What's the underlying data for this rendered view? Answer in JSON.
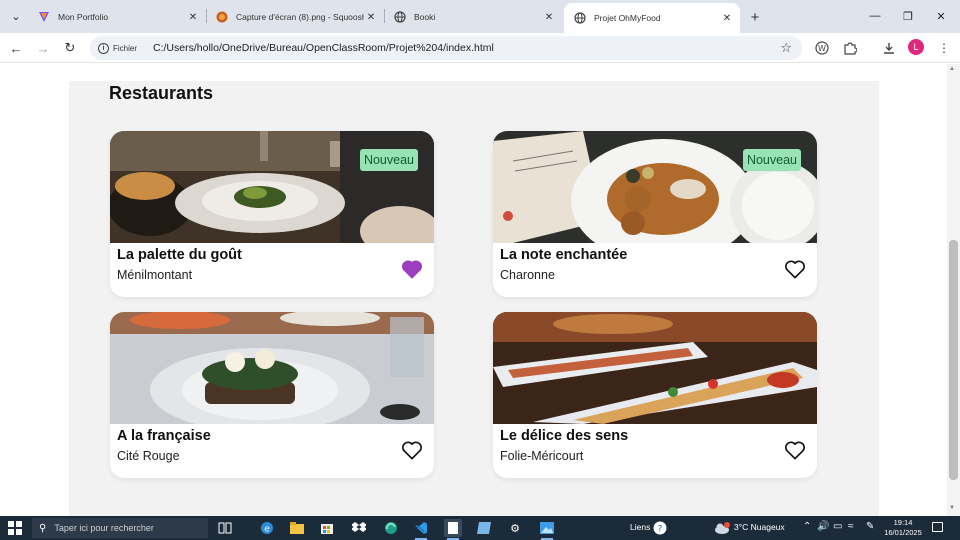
{
  "browser": {
    "tabs": [
      {
        "title": "Mon Portfolio",
        "icon": "portfolio-favicon",
        "active": false
      },
      {
        "title": "Capture d'écran (8).png - Squoosh",
        "icon": "squoosh-favicon",
        "active": false
      },
      {
        "title": "Booki",
        "icon": "globe-favicon",
        "active": false
      },
      {
        "title": "Projet OhMyFood",
        "icon": "globe-favicon",
        "active": true
      }
    ],
    "address": {
      "chip": "Fichier",
      "url": "C:/Users/hollo/OneDrive/Bureau/OpenClassRoom/Projet%204/index.html"
    },
    "profile_initial": "L",
    "accent_profile": "#e0267d"
  },
  "page": {
    "section_title": "Restaurants",
    "badge_color": "#99e2b4",
    "favorite_color": "#9b3fbf",
    "restaurants": [
      {
        "name": "La palette du goût",
        "location": "Ménilmontant",
        "badge": "Nouveau",
        "favorite": true
      },
      {
        "name": "La note enchantée",
        "location": "Charonne",
        "badge": "Nouveau",
        "favorite": false
      },
      {
        "name": "A la française",
        "location": "Cité Rouge",
        "badge": "",
        "favorite": false
      },
      {
        "name": "Le délice des sens",
        "location": "Folie-Méricourt",
        "badge": "",
        "favorite": false
      }
    ]
  },
  "taskbar": {
    "search_placeholder": "Taper ici pour rechercher",
    "links_label": "Liens",
    "weather": "3°C  Nuageux",
    "time": "19:14",
    "date": "16/01/2025"
  }
}
